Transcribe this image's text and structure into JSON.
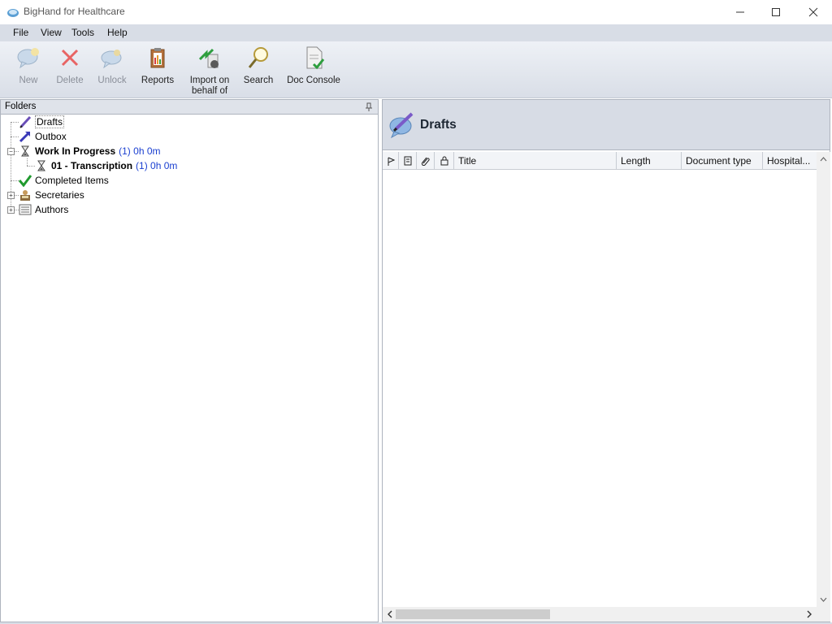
{
  "window": {
    "title": "BigHand for Healthcare"
  },
  "menu": [
    "File",
    "View",
    "Tools",
    "Help"
  ],
  "toolbar": {
    "new": "New",
    "delete": "Delete",
    "unlock": "Unlock",
    "reports": "Reports",
    "import_line1": "Import on",
    "import_line2": "behalf of",
    "search": "Search",
    "doc_console": "Doc Console"
  },
  "folders": {
    "title": "Folders",
    "items": [
      {
        "label": "Drafts"
      },
      {
        "label": "Outbox"
      },
      {
        "label": "Work In Progress",
        "count": "(1) 0h 0m"
      },
      {
        "label": "01 - Transcription",
        "count": "(1) 0h 0m"
      },
      {
        "label": "Completed Items"
      },
      {
        "label": "Secretaries"
      },
      {
        "label": "Authors"
      }
    ]
  },
  "content": {
    "title": "Drafts",
    "columns": {
      "title": "Title",
      "length": "Length",
      "doc_type": "Document type",
      "hospital": "Hospital..."
    }
  },
  "colors": {
    "count_text": "#1a3fd0",
    "menubar": "#d8dde6"
  }
}
